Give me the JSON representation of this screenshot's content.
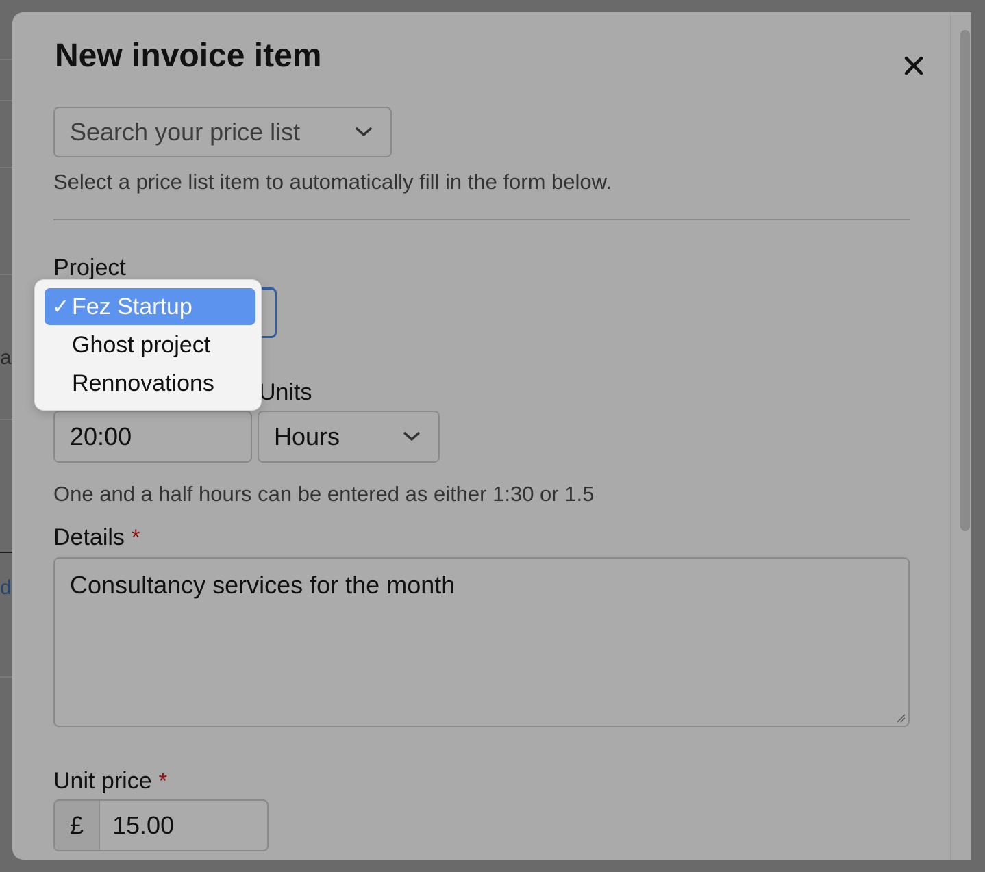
{
  "modal": {
    "title": "New invoice item",
    "close_label": "×"
  },
  "price_list": {
    "placeholder": "Search your price list",
    "help": "Select a price list item to automatically fill in the form below."
  },
  "project": {
    "label": "Project",
    "selected": "Fez Startup",
    "options": [
      {
        "label": "Fez Startup",
        "selected": true,
        "check": "✓"
      },
      {
        "label": "Ghost project",
        "selected": false,
        "check": ""
      },
      {
        "label": "Rennovations",
        "selected": false,
        "check": ""
      }
    ]
  },
  "quantity": {
    "value": "20:00",
    "help": "One and a half hours can be entered as either 1:30 or 1.5"
  },
  "units": {
    "label": "Units",
    "value": "Hours"
  },
  "details": {
    "label": "Details",
    "required": "*",
    "value": "Consultancy services for the month"
  },
  "unit_price": {
    "label": "Unit price",
    "required": "*",
    "currency": "£",
    "value": "15.00"
  },
  "background": {
    "fragment_1": "al",
    "fragment_2": "d"
  },
  "colors": {
    "overlay": "#aaaaaa",
    "accent": "#5c93ee",
    "focus_border": "#2e5fa3",
    "required": "#8f1010"
  }
}
